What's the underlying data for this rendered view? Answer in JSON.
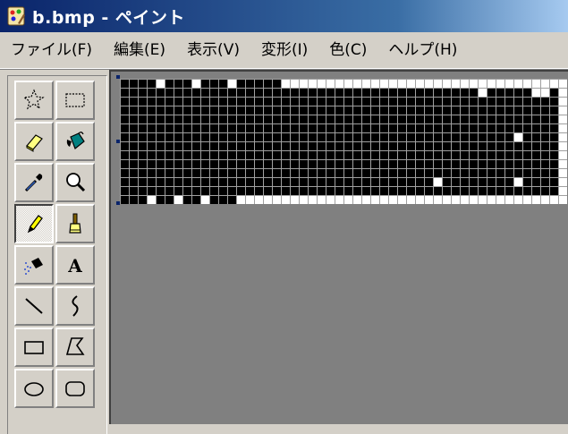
{
  "window": {
    "title": "b.bmp - ペイント",
    "app_icon": "paint-app-icon"
  },
  "menu": [
    {
      "label": "ファイル(F)"
    },
    {
      "label": "編集(E)"
    },
    {
      "label": "表示(V)"
    },
    {
      "label": "変形(I)"
    },
    {
      "label": "色(C)"
    },
    {
      "label": "ヘルプ(H)"
    }
  ],
  "tools": [
    {
      "name": "free-form-select-icon",
      "pressed": false
    },
    {
      "name": "rect-select-icon",
      "pressed": false
    },
    {
      "name": "eraser-icon",
      "pressed": false
    },
    {
      "name": "fill-bucket-icon",
      "pressed": false
    },
    {
      "name": "color-picker-icon",
      "pressed": false
    },
    {
      "name": "magnifier-icon",
      "pressed": false
    },
    {
      "name": "pencil-icon",
      "pressed": true
    },
    {
      "name": "brush-icon",
      "pressed": false
    },
    {
      "name": "airbrush-icon",
      "pressed": false
    },
    {
      "name": "text-icon",
      "pressed": false
    },
    {
      "name": "line-icon",
      "pressed": false
    },
    {
      "name": "curve-icon",
      "pressed": false
    },
    {
      "name": "rectangle-icon",
      "pressed": false
    },
    {
      "name": "polygon-icon",
      "pressed": false
    },
    {
      "name": "ellipse-icon",
      "pressed": false
    },
    {
      "name": "rounded-rect-icon",
      "pressed": false
    }
  ],
  "bitmap": {
    "rows": [
      "11110111011101111100000000000000000000000000000000",
      "11111111111111111111111111111111111111111111111110",
      "11111111111111111111111111111111111111111111111110",
      "11111111111111111111111111111111111111111111111110",
      "11111111111111111111111111111111111111111111111110",
      "11111111111111111111111111111111111111111111111110",
      "11111111111111111111111111111111111111111111111110",
      "11111111111111111111111111111111111111111111111110",
      "11111111111111111111111111111111111111111111111110",
      "11111111111111111111111111111111111111111111111110",
      "11111111111111111111111111111111111111111111111110",
      "11111111111111111111111111111111111111111111111110",
      "11111111111111111111111111111111111111111111111110",
      "11101101101110000000000000000000000000000000000000"
    ],
    "row_patches": [
      {
        "row": 1,
        "col": 40,
        "value": "0"
      },
      {
        "row": 1,
        "col": 46,
        "value": "0"
      },
      {
        "row": 1,
        "col": 47,
        "value": "0"
      },
      {
        "row": 6,
        "col": 44,
        "value": "0"
      },
      {
        "row": 11,
        "col": 35,
        "value": "0"
      },
      {
        "row": 11,
        "col": 44,
        "value": "0"
      }
    ],
    "colors": {
      "on": "#000000",
      "off": "#ffffff",
      "grid": "#a0a0a0"
    }
  }
}
